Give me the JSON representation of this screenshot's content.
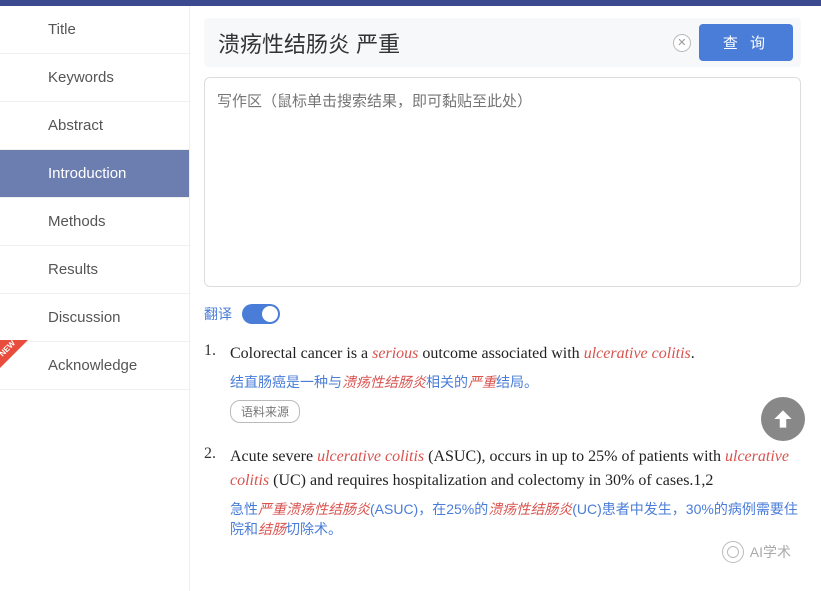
{
  "sidebar": {
    "items": [
      {
        "label": "Title"
      },
      {
        "label": "Keywords"
      },
      {
        "label": "Abstract"
      },
      {
        "label": "Introduction"
      },
      {
        "label": "Methods"
      },
      {
        "label": "Results"
      },
      {
        "label": "Discussion"
      },
      {
        "label": "Acknowledge"
      }
    ]
  },
  "search": {
    "value": "溃疡性结肠炎 严重",
    "query_label": "查 询"
  },
  "writing_area": {
    "placeholder": "写作区（鼠标单击搜索结果，即可黏贴至此处）"
  },
  "translate": {
    "label": "翻译"
  },
  "results": [
    {
      "num": "1.",
      "en_parts": [
        {
          "t": "Colorectal cancer is a ",
          "hl": false
        },
        {
          "t": "serious",
          "hl": true
        },
        {
          "t": " outcome associated with ",
          "hl": false
        },
        {
          "t": "ulcerative colitis",
          "hl": true
        },
        {
          "t": ".",
          "hl": false
        }
      ],
      "zh_parts": [
        {
          "t": "结直肠癌是一种与",
          "hl": false
        },
        {
          "t": "溃疡性结肠炎",
          "hl": true
        },
        {
          "t": "相关的",
          "hl": false
        },
        {
          "t": "严重",
          "hl": true
        },
        {
          "t": "结局。",
          "hl": false
        }
      ],
      "source_label": "语料来源"
    },
    {
      "num": "2.",
      "en_parts": [
        {
          "t": "Acute severe ",
          "hl": false
        },
        {
          "t": "ulcerative colitis",
          "hl": true
        },
        {
          "t": " (ASUC), occurs in up to 25% of patients with ",
          "hl": false
        },
        {
          "t": "ulcerative colitis",
          "hl": true
        },
        {
          "t": " (UC) and requires hospitalization and colectomy in 30% of cases.1,2",
          "hl": false
        }
      ],
      "zh_parts": [
        {
          "t": "急性",
          "hl": false
        },
        {
          "t": "严重溃疡性结肠炎",
          "hl": true
        },
        {
          "t": "(ASUC)，在25%的",
          "hl": false
        },
        {
          "t": "溃疡性结肠炎",
          "hl": true
        },
        {
          "t": "(UC)患者中发生，30%的病例需要住院和",
          "hl": false
        },
        {
          "t": "结肠",
          "hl": true
        },
        {
          "t": "切除术。",
          "hl": false
        }
      ]
    }
  ],
  "watermark": {
    "text": "AI学术"
  }
}
